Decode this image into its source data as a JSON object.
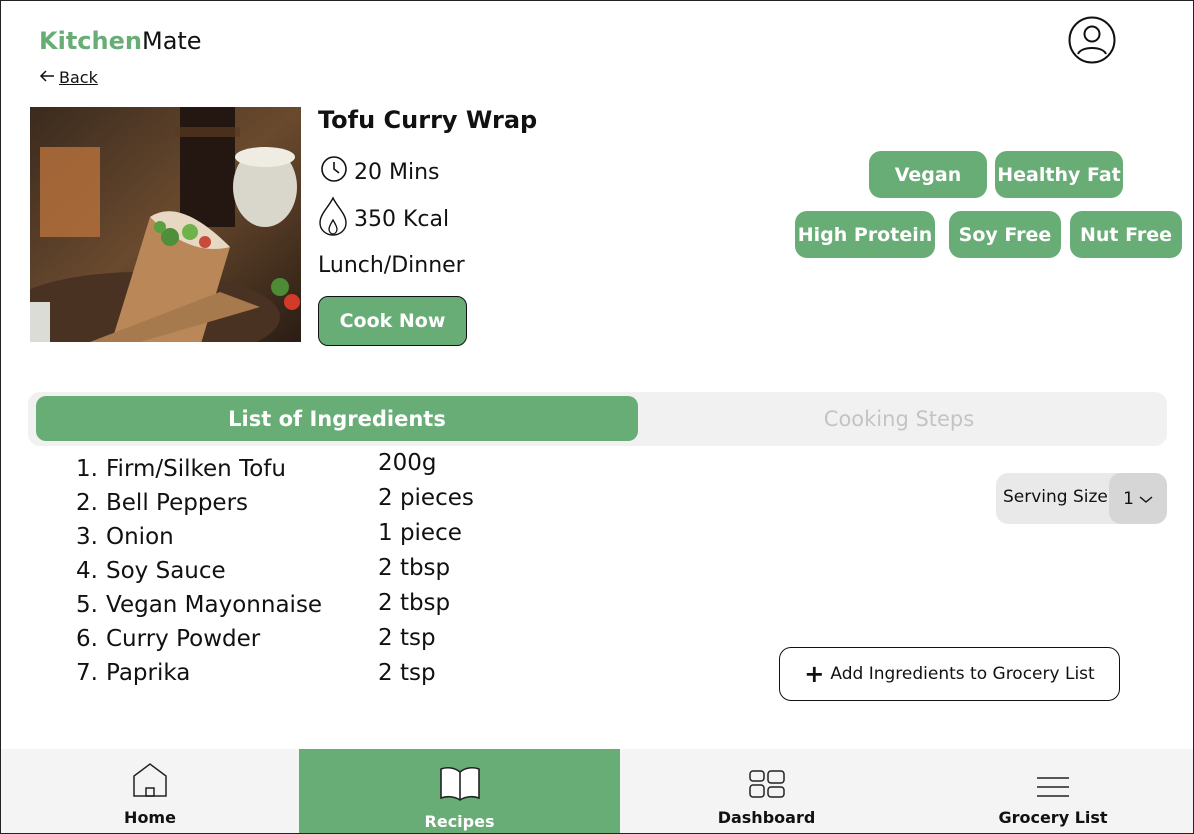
{
  "app": {
    "logo_part1": "Kitchen",
    "logo_part2": "Mate",
    "back_label": "Back"
  },
  "recipe": {
    "title": "Tofu Curry Wrap",
    "time": "20 Mins",
    "calories": "350 Kcal",
    "meal_type": "Lunch/Dinner",
    "cook_button": "Cook Now",
    "tags": [
      "Vegan",
      "Healthy Fat",
      "High Protein",
      "Soy Free",
      "Nut Free"
    ]
  },
  "tabs": {
    "active": "List of Ingredients",
    "inactive": "Cooking Steps"
  },
  "ingredients": [
    {
      "num": "1.",
      "name": "Firm/Silken Tofu",
      "qty": "200g"
    },
    {
      "num": "2.",
      "name": "Bell Peppers",
      "qty": "2 pieces"
    },
    {
      "num": "3.",
      "name": "Onion",
      "qty": "1 piece"
    },
    {
      "num": "4.",
      "name": "Soy Sauce",
      "qty": "2 tbsp"
    },
    {
      "num": "5.",
      "name": "Vegan Mayonnaise",
      "qty": "2 tbsp"
    },
    {
      "num": "6.",
      "name": "Curry Powder",
      "qty": "2 tsp"
    },
    {
      "num": "7.",
      "name": "Paprika",
      "qty": "2 tsp"
    }
  ],
  "serving": {
    "label": "Serving Size",
    "value": "1"
  },
  "add_to_grocery": "Add Ingredients to Grocery List",
  "nav": [
    {
      "label": "Home",
      "icon": "home-icon"
    },
    {
      "label": "Recipes",
      "icon": "book-icon"
    },
    {
      "label": "Dashboard",
      "icon": "dashboard-icon"
    },
    {
      "label": "Grocery List",
      "icon": "menu-lines-icon"
    }
  ],
  "colors": {
    "accent": "#69ad76",
    "tab_bg": "#f1f1f1",
    "nav_bg": "#f4f4f4"
  }
}
